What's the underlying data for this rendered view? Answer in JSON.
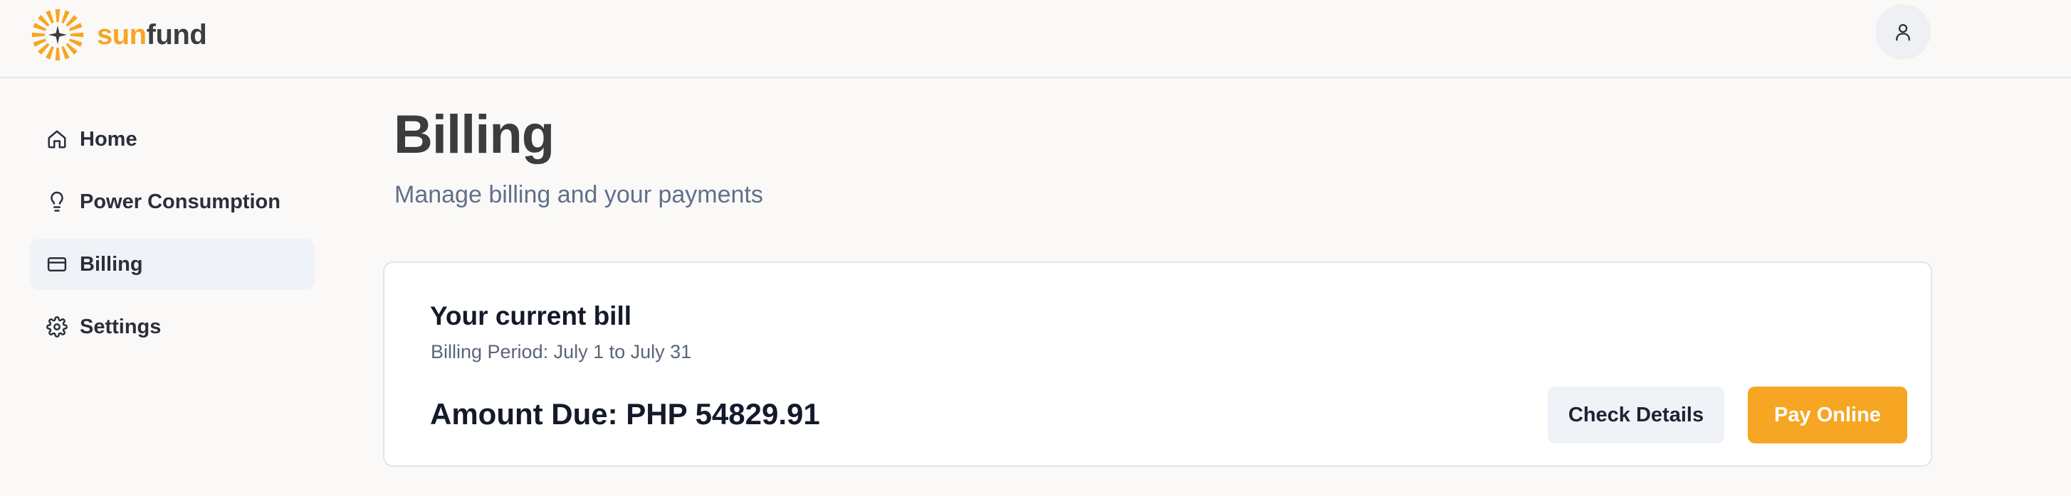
{
  "header": {
    "brand": {
      "part_a": "sun",
      "part_b": "fund",
      "accent_color": "#f5a623"
    },
    "user_icon": "user-icon"
  },
  "sidebar": {
    "items": [
      {
        "label": "Home",
        "icon": "home-icon",
        "active": false
      },
      {
        "label": "Power Consumption",
        "icon": "lightbulb-icon",
        "active": false
      },
      {
        "label": "Billing",
        "icon": "credit-card-icon",
        "active": true
      },
      {
        "label": "Settings",
        "icon": "gear-icon",
        "active": false
      }
    ]
  },
  "main": {
    "title": "Billing",
    "subtitle": "Manage billing and your payments",
    "bill": {
      "title": "Your current bill",
      "period": "Billing Period: July 1 to July 31",
      "amount_due": "Amount Due: PHP 54829.91",
      "check_details_label": "Check Details",
      "pay_online_label": "Pay Online"
    }
  },
  "colors": {
    "primary": "#f6a623",
    "background": "#faf9f8",
    "active_nav": "#eff2f7"
  }
}
